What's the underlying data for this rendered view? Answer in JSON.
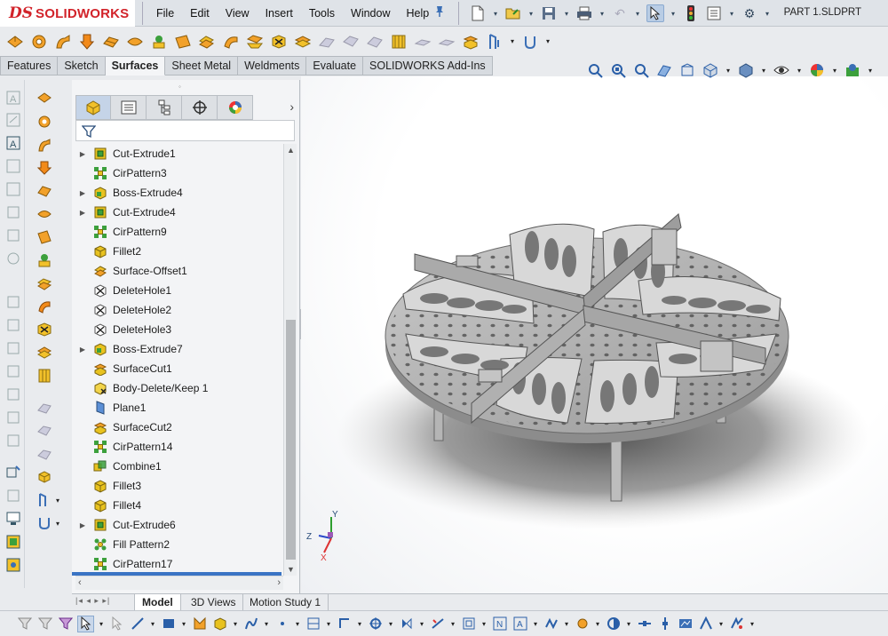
{
  "app": {
    "logo_ds": "DS",
    "logo_name": "SOLIDWORKS",
    "document_title": "PART 1.SLDPRT"
  },
  "menu": [
    "File",
    "Edit",
    "View",
    "Insert",
    "Tools",
    "Window",
    "Help"
  ],
  "command_tabs": [
    {
      "label": "Features",
      "active": false
    },
    {
      "label": "Sketch",
      "active": false
    },
    {
      "label": "Surfaces",
      "active": true
    },
    {
      "label": "Sheet Metal",
      "active": false
    },
    {
      "label": "Weldments",
      "active": false
    },
    {
      "label": "Evaluate",
      "active": false
    },
    {
      "label": "SOLIDWORKS Add-Ins",
      "active": false
    }
  ],
  "feature_tree": [
    {
      "label": "Cut-Extrude1",
      "icon": "cut-extrude-icon",
      "expandable": true
    },
    {
      "label": "CirPattern3",
      "icon": "circular-pattern-icon",
      "expandable": false
    },
    {
      "label": "Boss-Extrude4",
      "icon": "boss-extrude-icon",
      "expandable": true
    },
    {
      "label": "Cut-Extrude4",
      "icon": "cut-extrude-icon",
      "expandable": true
    },
    {
      "label": "CirPattern9",
      "icon": "circular-pattern-icon",
      "expandable": false
    },
    {
      "label": "Fillet2",
      "icon": "fillet-icon",
      "expandable": false
    },
    {
      "label": "Surface-Offset1",
      "icon": "surface-offset-icon",
      "expandable": false
    },
    {
      "label": "DeleteHole1",
      "icon": "delete-hole-icon",
      "expandable": false
    },
    {
      "label": "DeleteHole2",
      "icon": "delete-hole-icon",
      "expandable": false
    },
    {
      "label": "DeleteHole3",
      "icon": "delete-hole-icon",
      "expandable": false
    },
    {
      "label": "Boss-Extrude7",
      "icon": "boss-extrude-icon",
      "expandable": true
    },
    {
      "label": "SurfaceCut1",
      "icon": "surface-cut-icon",
      "expandable": false
    },
    {
      "label": "Body-Delete/Keep 1",
      "icon": "body-delete-icon",
      "expandable": false
    },
    {
      "label": "Plane1",
      "icon": "plane-icon",
      "expandable": false
    },
    {
      "label": "SurfaceCut2",
      "icon": "surface-cut-icon",
      "expandable": false
    },
    {
      "label": "CirPattern14",
      "icon": "circular-pattern-icon",
      "expandable": false
    },
    {
      "label": "Combine1",
      "icon": "combine-icon",
      "expandable": false
    },
    {
      "label": "Fillet3",
      "icon": "fillet-icon",
      "expandable": false
    },
    {
      "label": "Fillet4",
      "icon": "fillet-icon",
      "expandable": false
    },
    {
      "label": "Cut-Extrude6",
      "icon": "cut-extrude-icon",
      "expandable": true
    },
    {
      "label": "Fill Pattern2",
      "icon": "fill-pattern-icon",
      "expandable": false
    },
    {
      "label": "CirPattern17",
      "icon": "circular-pattern-icon",
      "expandable": false
    }
  ],
  "bottom_tabs": [
    {
      "label": "Model",
      "active": true
    },
    {
      "label": "3D Views",
      "active": false
    },
    {
      "label": "Motion Study 1",
      "active": false
    }
  ],
  "triad": {
    "x": "X",
    "y": "Y",
    "z": "Z"
  },
  "colors": {
    "accent": "#3a74c4",
    "brand_red": "#d2232a",
    "feature_yellow": "#e8c21f",
    "feature_green": "#3ca03c"
  }
}
